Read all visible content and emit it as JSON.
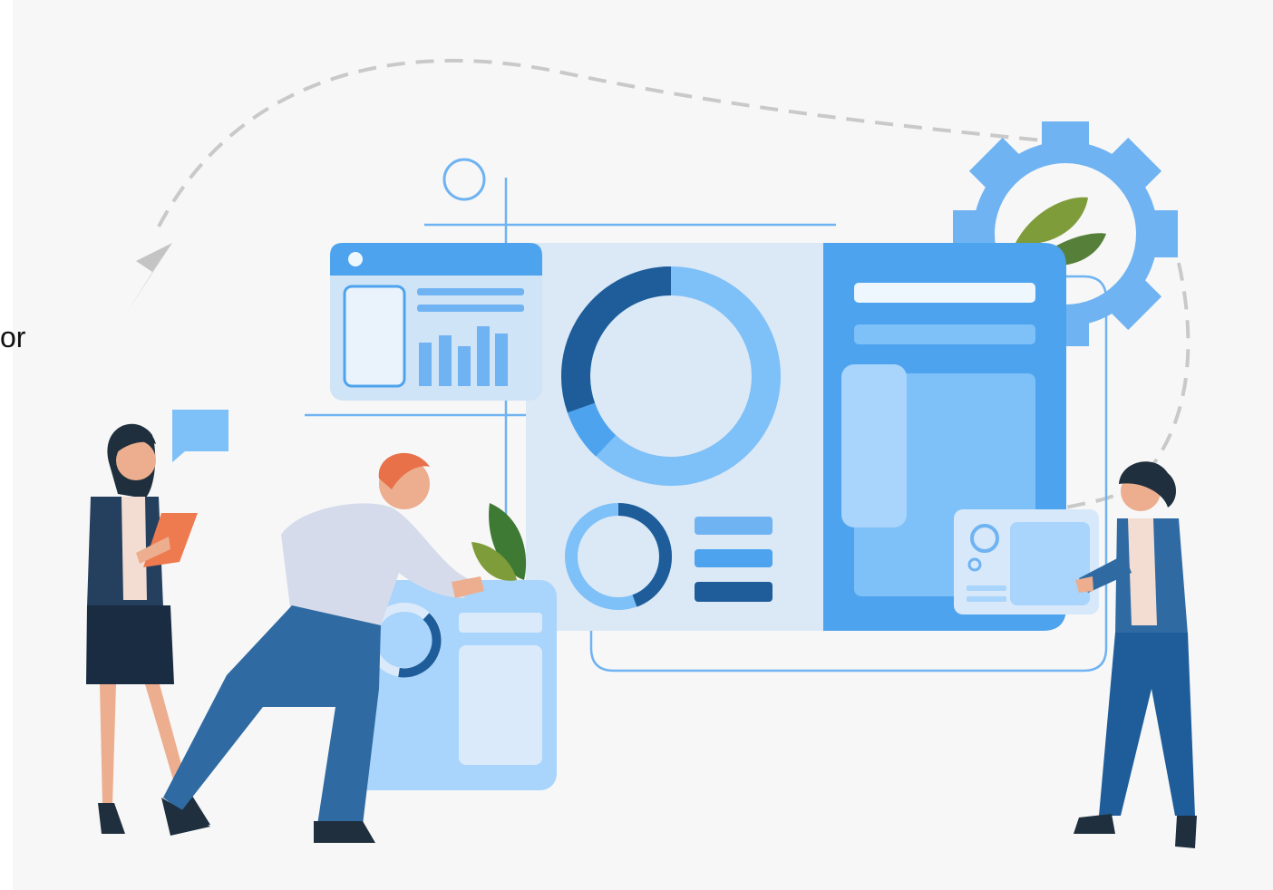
{
  "edge_text": "or",
  "colors": {
    "background": "#f7f7f7",
    "light_blue": "#7ec0f8",
    "mid_blue": "#4da3ee",
    "dark_blue": "#1e5d9a",
    "navy": "#25405e",
    "panel_pale": "#dbe8f5",
    "leaf_green": "#56803a",
    "hair_orange": "#e8714a",
    "clipboard_orange": "#ee7a4f"
  },
  "icons": [
    "gear-icon",
    "donut-chart-icon",
    "bar-chart-icon",
    "paper-plane-icon",
    "speech-bubble-icon",
    "leaf-icon"
  ]
}
